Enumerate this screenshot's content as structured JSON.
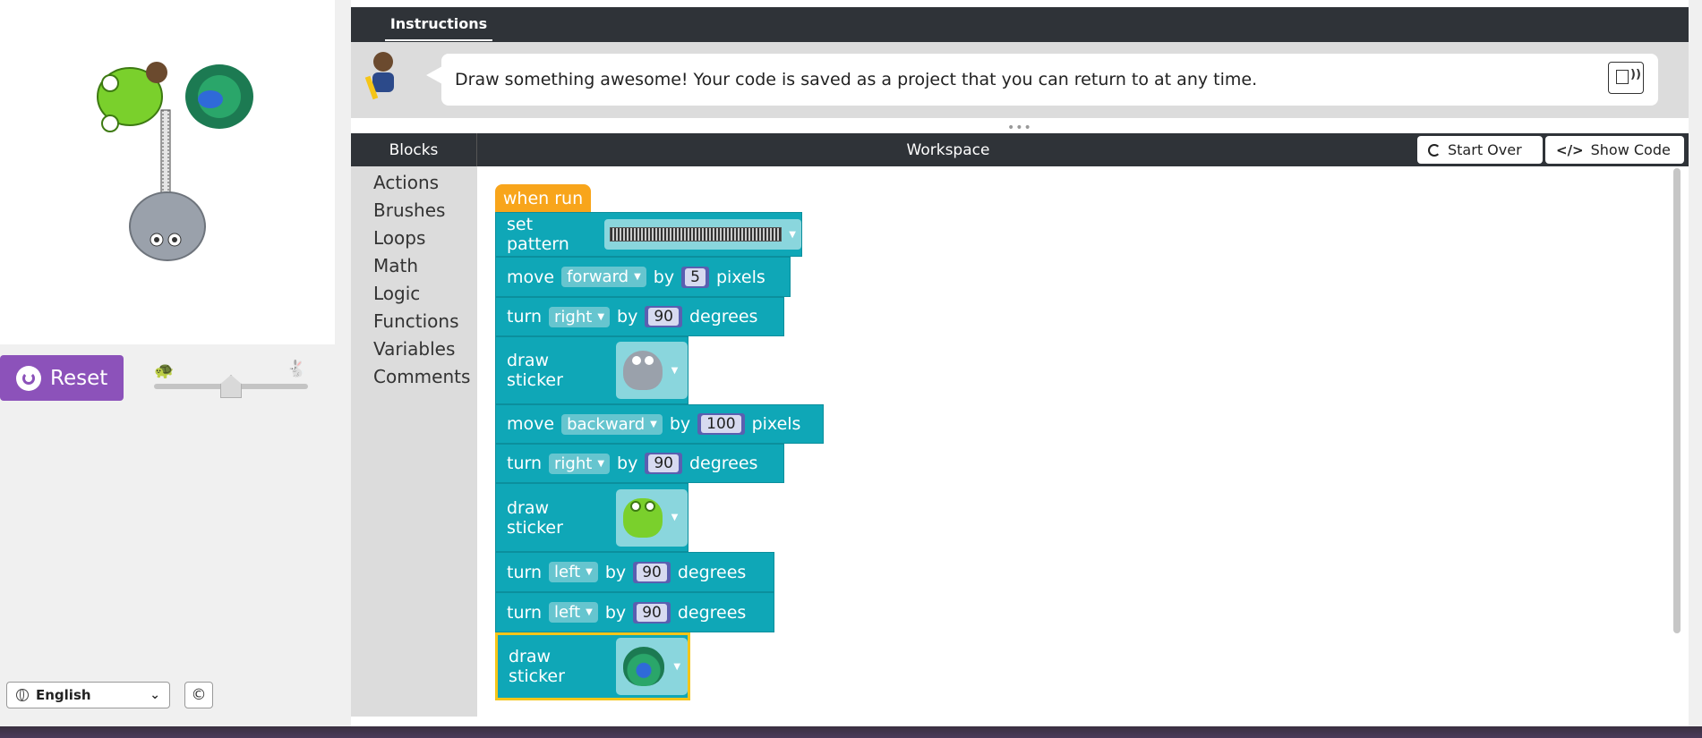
{
  "visualization": {
    "reset_label": "Reset",
    "speed_slider_value": 0.5
  },
  "footer": {
    "language": "English",
    "copyright_symbol": "©"
  },
  "instructions": {
    "tab_label": "Instructions",
    "text": "Draw something awesome! Your code is saved as a project that you can return to at any time."
  },
  "toolbox": {
    "header": "Blocks",
    "categories": [
      "Actions",
      "Brushes",
      "Loops",
      "Math",
      "Logic",
      "Functions",
      "Variables",
      "Comments"
    ]
  },
  "workspace": {
    "title": "Workspace",
    "start_over_label": "Start Over",
    "show_code_label": "Show Code"
  },
  "program": {
    "hat": "when run",
    "set_pattern": {
      "label": "set pattern"
    },
    "move1": {
      "label": "move",
      "direction": "forward",
      "by": "by",
      "value": "5",
      "unit": "pixels"
    },
    "turn1": {
      "label": "turn",
      "direction": "right",
      "by": "by",
      "value": "90",
      "unit": "degrees"
    },
    "sticker1": {
      "label": "draw sticker",
      "sticker": "elephant"
    },
    "move2": {
      "label": "move",
      "direction": "backward",
      "by": "by",
      "value": "100",
      "unit": "pixels"
    },
    "turn2": {
      "label": "turn",
      "direction": "right",
      "by": "by",
      "value": "90",
      "unit": "degrees"
    },
    "sticker2": {
      "label": "draw sticker",
      "sticker": "frog"
    },
    "turn3": {
      "label": "turn",
      "direction": "left",
      "by": "by",
      "value": "90",
      "unit": "degrees"
    },
    "turn4": {
      "label": "turn",
      "direction": "left",
      "by": "by",
      "value": "90",
      "unit": "degrees"
    },
    "sticker3": {
      "label": "draw sticker",
      "sticker": "peacock"
    }
  },
  "colors": {
    "block": "#0fa7b7",
    "hat": "#f8a51b",
    "reset": "#8c52ba",
    "header": "#2f3338",
    "selected_outline": "#f5c518"
  }
}
